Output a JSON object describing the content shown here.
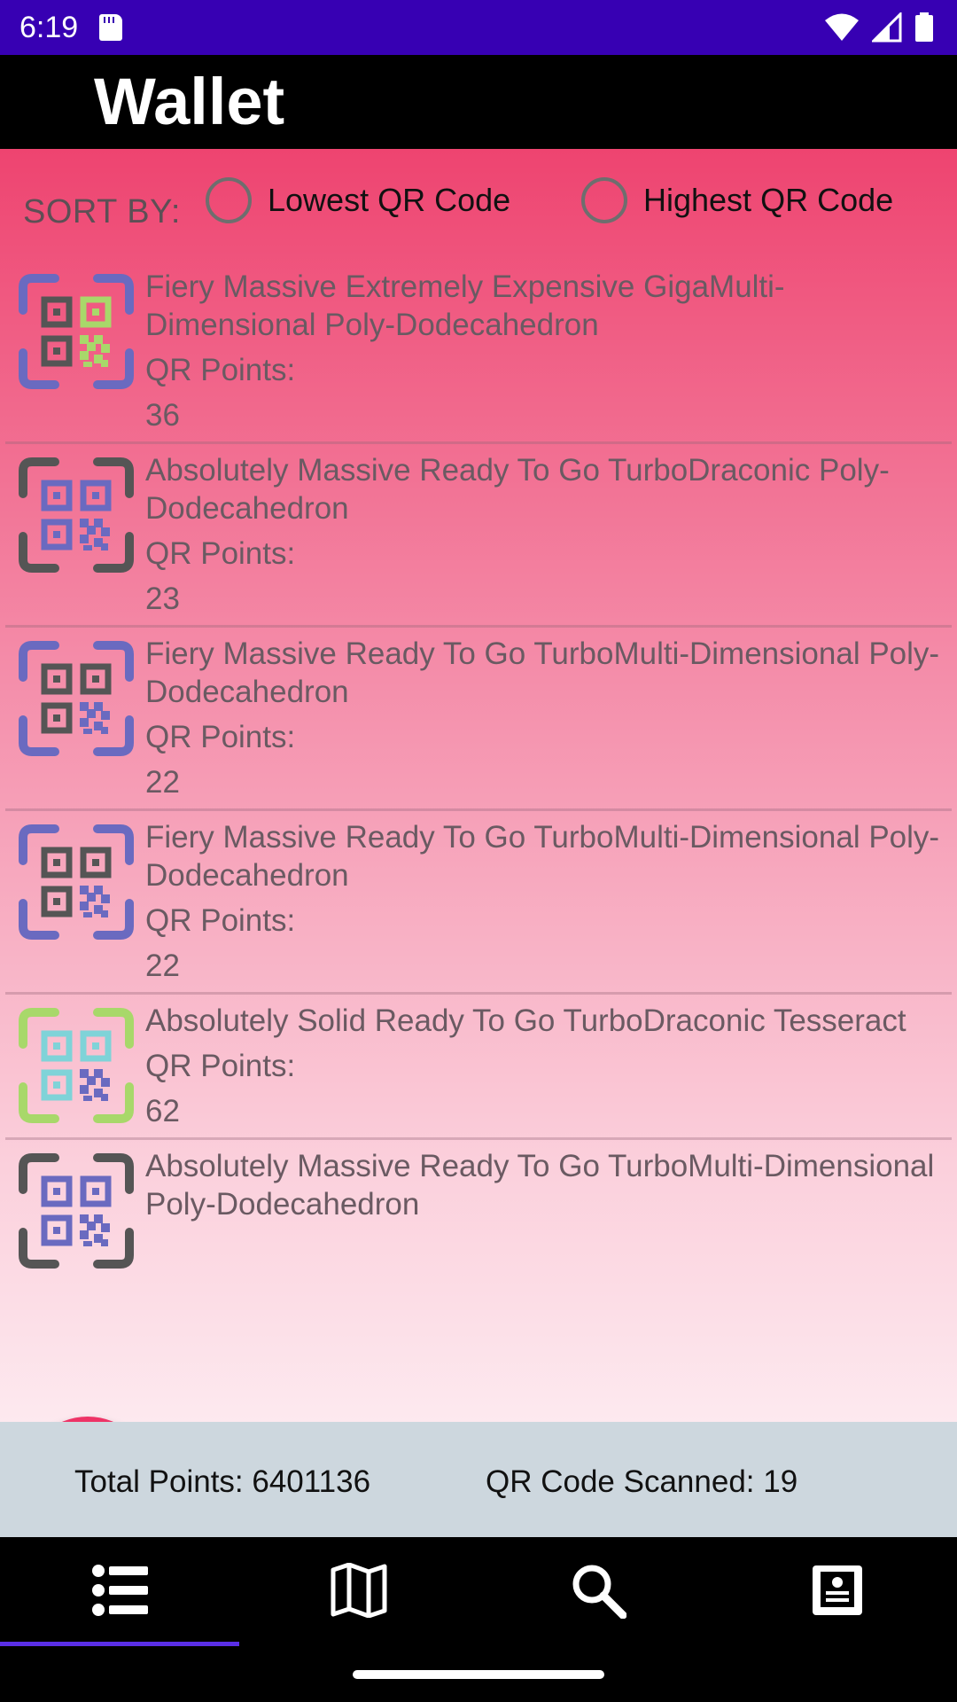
{
  "status_bar": {
    "time": "6:19"
  },
  "app_bar": {
    "title": "Wallet"
  },
  "sort": {
    "label": "SORT BY:",
    "options": [
      "Lowest QR Code",
      "Highest QR Code"
    ]
  },
  "qr_items": [
    {
      "name": "Fiery Massive Extremely Expensive GigaMulti-Dimensional Poly-Dodecahedron",
      "points_label": "QR Points:",
      "points": "36",
      "frame_color": "#6a6ac0",
      "block_colors": [
        "#555555",
        "#a8d86a",
        "#555555",
        "#a8d86a"
      ]
    },
    {
      "name": "Absolutely Massive Ready To Go TurboDraconic Poly-Dodecahedron",
      "points_label": "QR Points:",
      "points": "23",
      "frame_color": "#555555",
      "block_colors": [
        "#6a6ac0",
        "#6a6ac0",
        "#6a6ac0",
        "#6a6ac0"
      ]
    },
    {
      "name": "Fiery Massive Ready To Go TurboMulti-Dimensional Poly-Dodecahedron",
      "points_label": "QR Points:",
      "points": "22",
      "frame_color": "#6a6ac0",
      "block_colors": [
        "#555555",
        "#555555",
        "#555555",
        "#6a6ac0"
      ]
    },
    {
      "name": "Fiery Massive Ready To Go TurboMulti-Dimensional Poly-Dodecahedron",
      "points_label": "QR Points:",
      "points": "22",
      "frame_color": "#6a6ac0",
      "block_colors": [
        "#555555",
        "#555555",
        "#555555",
        "#6a6ac0"
      ]
    },
    {
      "name": "Absolutely Solid Ready To Go TurboDraconic Tesseract",
      "points_label": "QR Points:",
      "points": "62",
      "frame_color": "#a8d86a",
      "block_colors": [
        "#7fd3d8",
        "#7fd3d8",
        "#7fd3d8",
        "#6a6ac0"
      ]
    },
    {
      "name": "Absolutely Massive Ready To Go TurboMulti-Dimensional Poly-Dodecahedron",
      "points_label": "",
      "points": "",
      "frame_color": "#555555",
      "block_colors": [
        "#6a6ac0",
        "#6a6ac0",
        "#6a6ac0",
        "#6a6ac0"
      ]
    }
  ],
  "footer": {
    "total_points": "Total Points: 6401136",
    "qr_scanned": "QR Code Scanned: 19"
  },
  "fab": {
    "icon": "plus-icon",
    "color": "#ee3366"
  },
  "nav": {
    "items": [
      "list-icon",
      "map-icon",
      "search-icon",
      "profile-icon"
    ],
    "selected": 0,
    "indicator_color": "#5a2ee6"
  },
  "colors": {
    "status_bar": "#3700b3",
    "app_bar": "#000000",
    "footer": "#cdd7de"
  }
}
